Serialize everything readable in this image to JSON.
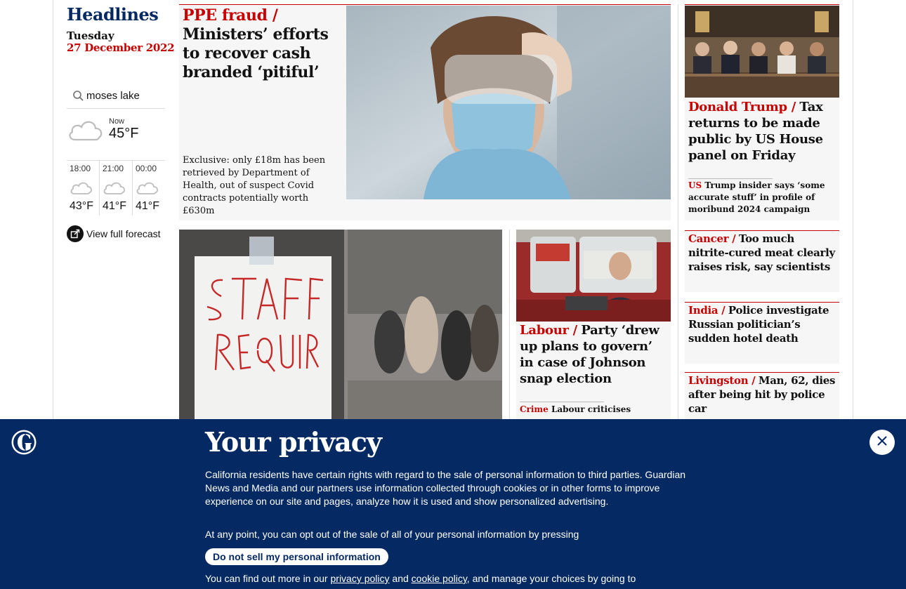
{
  "sidebar": {
    "title": "Headlines",
    "day": "Tuesday",
    "date": "27 December 2022",
    "search": {
      "icon": "search-icon",
      "location": "moses lake"
    },
    "weather_now": {
      "label": "Now",
      "temp": "45°F",
      "icon": "cloud-icon"
    },
    "forecast": [
      {
        "time": "18:00",
        "temp": "43°F",
        "icon": "cloud-icon"
      },
      {
        "time": "21:00",
        "temp": "41°F",
        "icon": "cloud-icon"
      },
      {
        "time": "00:00",
        "temp": "41°F",
        "icon": "cloud-icon"
      }
    ],
    "full_forecast": "View full forecast"
  },
  "stories": {
    "lead": {
      "kicker": "PPE fraud /",
      "headline": "Ministers’ efforts to recover cash branded ‘pitiful’",
      "standfirst": "Exclusive: only £18m has been retrieved by Department of Health, out of suspect Covid contracts potentially worth £630m"
    },
    "trump": {
      "kicker": "Donald Trump /",
      "headline": "Tax returns to be made public by US House panel on Friday",
      "sub_kicker": "US",
      "sub_headline": "Trump insider says ‘some accurate stuff’ in profile of moribund 2024 campaign"
    },
    "labour": {
      "kicker": "Labour /",
      "headline": "Party ‘drew up plans to govern’ in case of Johnson snap election",
      "sub_kicker": "Crime",
      "sub_headline": "Labour criticises"
    },
    "small": [
      {
        "kicker": "Cancer /",
        "headline": "Too much nitrite-cured meat clearly raises risk, say scientists"
      },
      {
        "kicker": "India /",
        "headline": "Police investigate Russian politician’s sudden hotel death"
      },
      {
        "kicker": "Livingston /",
        "headline": "Man, 62, dies after being hit by police car"
      }
    ]
  },
  "privacy": {
    "title": "Your privacy",
    "body": "California residents have certain rights with regard to the sale of personal information to third parties. Guardian News and Media and our partners use information collected through cookies or in other forms to improve experience on our site and pages, analyze how it is used and show personalized advertising.",
    "body2": "At any point, you can opt out of the sale of all of your personal information by pressing",
    "button": "Do not sell my personal information",
    "more_prefix": "You can find out more in our",
    "privacy_link": "privacy policy",
    "and": "and",
    "cookie_link": "cookie policy",
    "more_suffix": ", and manage your choices by going to",
    "colors": {
      "banner": "#052962",
      "accent": "#c70000"
    }
  }
}
